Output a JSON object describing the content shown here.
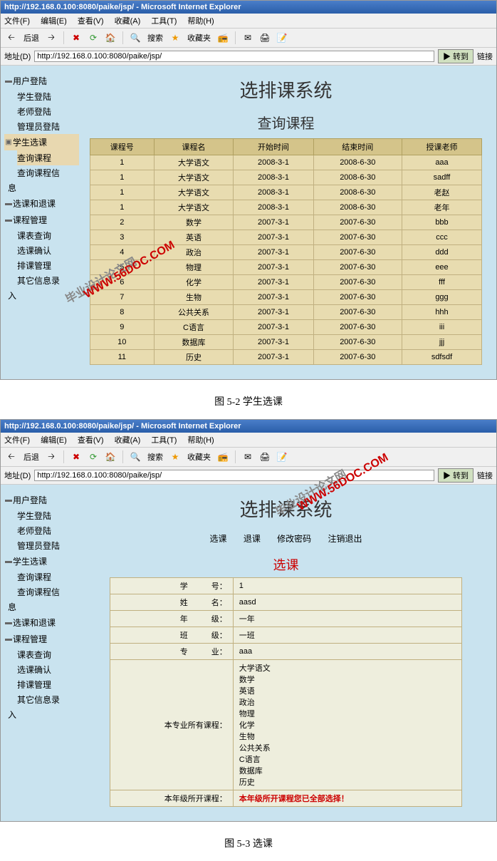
{
  "shot1": {
    "titlebar": "http://192.168.0.100:8080/paike/jsp/ - Microsoft Internet Explorer",
    "menubar": [
      "文件(F)",
      "编辑(E)",
      "查看(V)",
      "收藏(A)",
      "工具(T)",
      "帮助(H)"
    ],
    "toolbar": {
      "back": "后退",
      "search": "搜索",
      "fav": "收藏夹"
    },
    "addr": {
      "label": "地址(D)",
      "value": "http://192.168.0.100:8080/paike/jsp/",
      "go": "转到",
      "link": "链接"
    },
    "pagetitle": "选排课系统",
    "sectitle": "查询课程",
    "sidebar": {
      "g1": {
        "title": "用户登陆",
        "items": [
          "学生登陆",
          "老师登陆",
          "管理员登陆"
        ]
      },
      "g2": {
        "title": "学生选课",
        "items": [
          "查询课程",
          "查询课程信"
        ]
      },
      "g3": {
        "title": "选课和退课",
        "items": []
      },
      "g4": {
        "title": "课程管理",
        "items": [
          "课表查询",
          "选课确认",
          "排课管理",
          "其它信息录"
        ]
      },
      "trail1": "息",
      "trail2": "入"
    },
    "table": {
      "headers": [
        "课程号",
        "课程名",
        "开始时间",
        "结束时间",
        "授课老师"
      ],
      "rows": [
        [
          "1",
          "大学语文",
          "2008-3-1",
          "2008-6-30",
          "aaa"
        ],
        [
          "1",
          "大学语文",
          "2008-3-1",
          "2008-6-30",
          "sadff"
        ],
        [
          "1",
          "大学语文",
          "2008-3-1",
          "2008-6-30",
          "老赵"
        ],
        [
          "1",
          "大学语文",
          "2008-3-1",
          "2008-6-30",
          "老年"
        ],
        [
          "2",
          "数学",
          "2007-3-1",
          "2007-6-30",
          "bbb"
        ],
        [
          "3",
          "英语",
          "2007-3-1",
          "2007-6-30",
          "ccc"
        ],
        [
          "4",
          "政治",
          "2007-3-1",
          "2007-6-30",
          "ddd"
        ],
        [
          "5",
          "物理",
          "2007-3-1",
          "2007-6-30",
          "eee"
        ],
        [
          "6",
          "化学",
          "2007-3-1",
          "2007-6-30",
          "fff"
        ],
        [
          "7",
          "生物",
          "2007-3-1",
          "2007-6-30",
          "ggg"
        ],
        [
          "8",
          "公共关系",
          "2007-3-1",
          "2007-6-30",
          "hhh"
        ],
        [
          "9",
          "C语言",
          "2007-3-1",
          "2007-6-30",
          "iii"
        ],
        [
          "10",
          "数据库",
          "2007-3-1",
          "2007-6-30",
          "jjj"
        ],
        [
          "11",
          "历史",
          "2007-3-1",
          "2007-6-30",
          "sdfsdf"
        ]
      ]
    }
  },
  "caption1": "图 5-2 学生选课",
  "shot2": {
    "titlebar": "http://192.168.0.100:8080/paike/jsp/ - Microsoft Internet Explorer",
    "menubar": [
      "文件(F)",
      "编辑(E)",
      "查看(V)",
      "收藏(A)",
      "工具(T)",
      "帮助(H)"
    ],
    "toolbar": {
      "back": "后退",
      "search": "搜索",
      "fav": "收藏夹"
    },
    "addr": {
      "label": "地址(D)",
      "value": "http://192.168.0.100:8080/paike/jsp/",
      "go": "转到",
      "link": "链接"
    },
    "pagetitle": "选排课系统",
    "topnav": [
      "选课",
      "退课",
      "修改密码",
      "注销退出"
    ],
    "formtitle": "选课",
    "sidebar": {
      "g1": {
        "title": "用户登陆",
        "items": [
          "学生登陆",
          "老师登陆",
          "管理员登陆"
        ]
      },
      "g2": {
        "title": "学生选课",
        "items": [
          "查询课程",
          "查询课程信"
        ]
      },
      "g3": {
        "title": "选课和退课",
        "items": []
      },
      "g4": {
        "title": "课程管理",
        "items": [
          "课表查询",
          "选课确认",
          "排课管理",
          "其它信息录"
        ]
      },
      "trail1": "息",
      "trail2": "入"
    },
    "form": {
      "rows": [
        {
          "label": "学　　　号：",
          "value": "1"
        },
        {
          "label": "姓　　　名：",
          "value": "aasd"
        },
        {
          "label": "年　　　级：",
          "value": "一年"
        },
        {
          "label": "班　　　级：",
          "value": "一班"
        },
        {
          "label": "专　　　业：",
          "value": "aaa"
        }
      ],
      "courses_label": "本专业所有课程：",
      "courses": [
        "大学语文",
        "数学",
        "英语",
        "政治",
        "物理",
        "化学",
        "生物",
        "公共关系",
        "C语言",
        "数据库",
        "历史"
      ],
      "last_label": "本年级所开课程：",
      "last_value": "本年级所开课程您已全部选择！"
    }
  },
  "caption2": "图 5-3 选课",
  "watermark": {
    "cn": "毕业设计论文网",
    "en": "WWW.56DOC.COM"
  }
}
